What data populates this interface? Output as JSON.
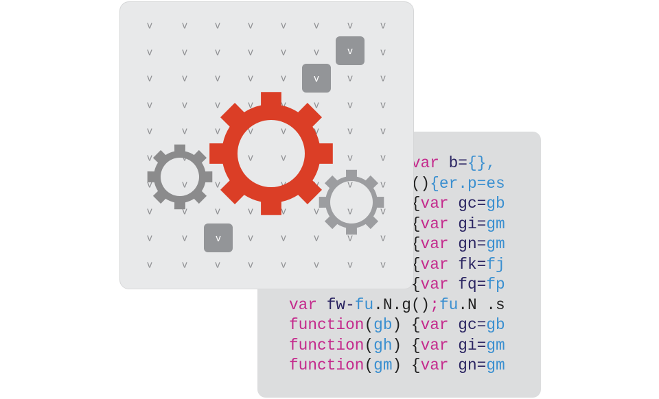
{
  "glyph": "v",
  "colors": {
    "red_gear": "#db3e26",
    "gray_gear_left": "#8b8b8c",
    "gray_gear_right": "#9c9da0",
    "keyword": "#c42a8c",
    "identifier": "#2b2562",
    "value": "#3a8fd0",
    "box": "#939598"
  },
  "code_lines": [
    [
      {
        "t": "             ",
        "c": "pn"
      },
      {
        "t": "var",
        "c": "kw"
      },
      {
        "t": " b=",
        "c": "id"
      },
      {
        "t": "{},",
        "c": "bl"
      }
    ],
    [
      {
        "t": "             ",
        "c": "pn"
      },
      {
        "t": "()",
        "c": "pn"
      },
      {
        "t": "{er.p=es",
        "c": "bl"
      }
    ],
    [
      {
        "t": "             ",
        "c": "pn"
      },
      {
        "t": "{",
        "c": "pn"
      },
      {
        "t": "var",
        "c": "kw"
      },
      {
        "t": " gc=",
        "c": "id"
      },
      {
        "t": "gb",
        "c": "bl"
      }
    ],
    [
      {
        "t": "             ",
        "c": "pn"
      },
      {
        "t": "{",
        "c": "pn"
      },
      {
        "t": "var",
        "c": "kw"
      },
      {
        "t": " gi=",
        "c": "id"
      },
      {
        "t": "gm",
        "c": "bl"
      }
    ],
    [
      {
        "t": "             ",
        "c": "pn"
      },
      {
        "t": "{",
        "c": "pn"
      },
      {
        "t": "var",
        "c": "kw"
      },
      {
        "t": " gn=",
        "c": "id"
      },
      {
        "t": "gm",
        "c": "bl"
      }
    ],
    [
      {
        "t": "             ",
        "c": "pn"
      },
      {
        "t": "{",
        "c": "pn"
      },
      {
        "t": "var",
        "c": "kw"
      },
      {
        "t": " fk=",
        "c": "id"
      },
      {
        "t": "fj",
        "c": "bl"
      }
    ],
    [
      {
        "t": "             ",
        "c": "pn"
      },
      {
        "t": "{",
        "c": "pn"
      },
      {
        "t": "var",
        "c": "kw"
      },
      {
        "t": " fq=",
        "c": "id"
      },
      {
        "t": "fp",
        "c": "bl"
      }
    ],
    [
      {
        "t": "var",
        "c": "kw"
      },
      {
        "t": " fw-",
        "c": "id"
      },
      {
        "t": "fu",
        "c": "bl"
      },
      {
        "t": ".N.g()",
        "c": "pn"
      },
      {
        "t": ";",
        "c": "kw"
      },
      {
        "t": "fu",
        "c": "bl"
      },
      {
        "t": ".N .s",
        "c": "pn"
      }
    ],
    [
      {
        "t": "function",
        "c": "kw"
      },
      {
        "t": "(",
        "c": "pn"
      },
      {
        "t": "gb",
        "c": "bl"
      },
      {
        "t": ") {",
        "c": "pn"
      },
      {
        "t": "var",
        "c": "kw"
      },
      {
        "t": " gc=",
        "c": "id"
      },
      {
        "t": "gb",
        "c": "bl"
      }
    ],
    [
      {
        "t": "function",
        "c": "kw"
      },
      {
        "t": "(",
        "c": "pn"
      },
      {
        "t": "gh",
        "c": "bl"
      },
      {
        "t": ") {",
        "c": "pn"
      },
      {
        "t": "var",
        "c": "kw"
      },
      {
        "t": " gi=",
        "c": "id"
      },
      {
        "t": "gm",
        "c": "bl"
      }
    ],
    [
      {
        "t": "function",
        "c": "kw"
      },
      {
        "t": "(",
        "c": "pn"
      },
      {
        "t": "gm",
        "c": "bl"
      },
      {
        "t": ") {",
        "c": "pn"
      },
      {
        "t": "var",
        "c": "kw"
      },
      {
        "t": " gn=",
        "c": "id"
      },
      {
        "t": "gm",
        "c": "bl"
      }
    ]
  ]
}
